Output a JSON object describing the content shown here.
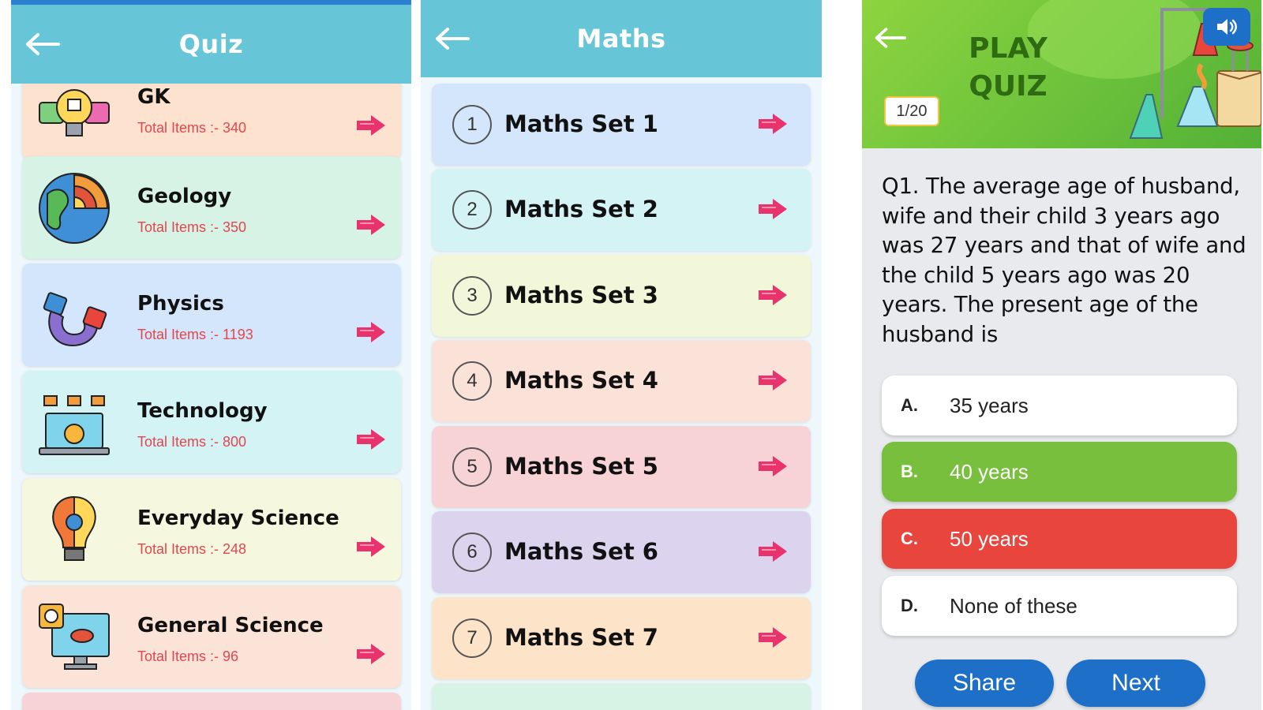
{
  "quiz_screen": {
    "title": "Quiz",
    "categories": [
      {
        "name": "GK",
        "count": "Total Items :- 340",
        "icon": "lightbulb-icon",
        "bg": "#fde3cf"
      },
      {
        "name": "Geology",
        "count": "Total Items :- 350",
        "icon": "globe-icon",
        "bg": "#d6f3e6"
      },
      {
        "name": "Physics",
        "count": "Total Items :- 1193",
        "icon": "magnet-icon",
        "bg": "#d3e6fb"
      },
      {
        "name": "Technology",
        "count": "Total Items :- 800",
        "icon": "laptop-icon",
        "bg": "#d3f3f5"
      },
      {
        "name": "Everyday Science",
        "count": "Total Items :- 248",
        "icon": "bulb-gear-icon",
        "bg": "#f5f8df"
      },
      {
        "name": "General Science",
        "count": "Total Items :- 96",
        "icon": "monitor-science-icon",
        "bg": "#fbe3d8"
      }
    ]
  },
  "maths_screen": {
    "title": "Maths",
    "sets": [
      {
        "num": "1",
        "name": "Maths Set 1",
        "bg": "#d3e6fb"
      },
      {
        "num": "2",
        "name": "Maths Set 2",
        "bg": "#d4f3f5"
      },
      {
        "num": "3",
        "name": "Maths Set 3",
        "bg": "#f2f7da"
      },
      {
        "num": "4",
        "name": "Maths Set 4",
        "bg": "#fbe2d8"
      },
      {
        "num": "5",
        "name": "Maths Set 5",
        "bg": "#f8d3d5"
      },
      {
        "num": "6",
        "name": "Maths Set 6",
        "bg": "#dcd3ef"
      },
      {
        "num": "7",
        "name": "Maths Set 7",
        "bg": "#fde3c8"
      }
    ]
  },
  "play_screen": {
    "banner_line1": "PLAY",
    "banner_line2": "QUIZ",
    "counter": "1/20",
    "question": "Q1. The average age of husband, wife and their child 3 years ago was 27 years and that of wife and the child 5 years ago was 20 years. The present age of the husband is",
    "options": [
      {
        "letter": "A.",
        "text": "35 years",
        "bg": "#ffffff",
        "color": "#222222"
      },
      {
        "letter": "B.",
        "text": "40 years",
        "bg": "#77bf3c",
        "color": "#ffffff"
      },
      {
        "letter": "C.",
        "text": "50 years",
        "bg": "#e8453c",
        "color": "#ffffff"
      },
      {
        "letter": "D.",
        "text": "None of these",
        "bg": "#ffffff",
        "color": "#222222"
      }
    ],
    "share_label": "Share",
    "next_label": "Next"
  },
  "colors": {
    "header": "#67c5d8",
    "arrow": "#e8336c",
    "primary_button": "#1e6fc8",
    "count_text": "#e1474f"
  }
}
